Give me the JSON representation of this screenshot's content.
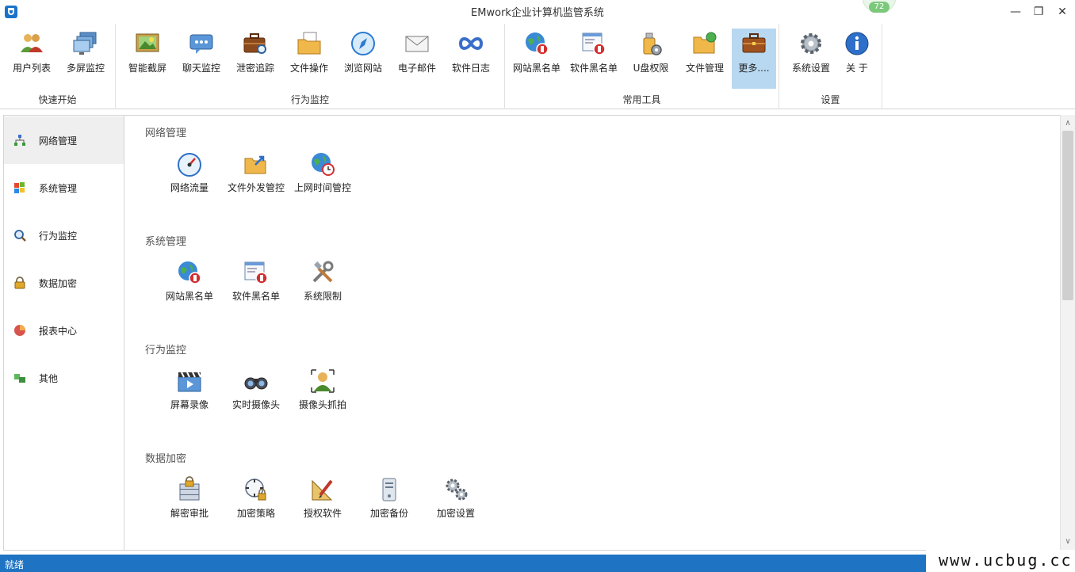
{
  "window": {
    "title": "EMwork企业计算机监管系统",
    "badge": "72",
    "min": "—",
    "max": "❐",
    "close": "✕"
  },
  "ribbon": {
    "groups": [
      {
        "label": "快速开始",
        "buttons": [
          {
            "label": "用户列表",
            "icon": "users-icon"
          },
          {
            "label": "多屏监控",
            "icon": "multi-screen-icon"
          }
        ]
      },
      {
        "label": "行为监控",
        "buttons": [
          {
            "label": "智能截屏",
            "icon": "screenshot-icon"
          },
          {
            "label": "聊天监控",
            "icon": "chat-icon"
          },
          {
            "label": "泄密追踪",
            "icon": "briefcase-search-icon"
          },
          {
            "label": "文件操作",
            "icon": "file-folder-icon"
          },
          {
            "label": "浏览网站",
            "icon": "compass-icon"
          },
          {
            "label": "电子邮件",
            "icon": "mail-icon"
          },
          {
            "label": "软件日志",
            "icon": "infinity-icon"
          }
        ]
      },
      {
        "label": "常用工具",
        "buttons": [
          {
            "label": "网站黑名单",
            "icon": "globe-block-icon"
          },
          {
            "label": "软件黑名单",
            "icon": "window-block-icon"
          },
          {
            "label": "U盘权限",
            "icon": "usb-gear-icon"
          },
          {
            "label": "文件管理",
            "icon": "folder-globe-icon"
          },
          {
            "label": "更多....",
            "icon": "toolbox-icon"
          }
        ]
      },
      {
        "label": "设置",
        "buttons": [
          {
            "label": "系统设置",
            "icon": "gear-icon"
          },
          {
            "label": "关 于",
            "icon": "info-icon"
          }
        ]
      }
    ]
  },
  "sidebar": {
    "items": [
      {
        "label": "网络管理",
        "icon": "network-icon"
      },
      {
        "label": "系统管理",
        "icon": "windows-logo-icon"
      },
      {
        "label": "行为监控",
        "icon": "magnifier-icon"
      },
      {
        "label": "数据加密",
        "icon": "lock-icon"
      },
      {
        "label": "报表中心",
        "icon": "pie-chart-icon"
      },
      {
        "label": "其他",
        "icon": "blocks-icon"
      }
    ]
  },
  "sections": [
    {
      "title": "网络管理",
      "items": [
        {
          "label": "网络流量",
          "icon": "speedometer-icon"
        },
        {
          "label": "文件外发管控",
          "icon": "folder-send-icon"
        },
        {
          "label": "上网时间管控",
          "icon": "globe-clock-icon"
        }
      ]
    },
    {
      "title": "系统管理",
      "items": [
        {
          "label": "网站黑名单",
          "icon": "globe-block-icon"
        },
        {
          "label": "软件黑名单",
          "icon": "window-block-icon"
        },
        {
          "label": "系统限制",
          "icon": "tools-icon"
        }
      ]
    },
    {
      "title": "行为监控",
      "items": [
        {
          "label": "屏幕录像",
          "icon": "clapper-icon"
        },
        {
          "label": "实时摄像头",
          "icon": "binoculars-icon"
        },
        {
          "label": "摄像头抓拍",
          "icon": "person-capture-icon"
        }
      ]
    },
    {
      "title": "数据加密",
      "items": [
        {
          "label": "解密审批",
          "icon": "lock-cabinet-icon"
        },
        {
          "label": "加密策略",
          "icon": "target-lock-icon"
        },
        {
          "label": "授权软件",
          "icon": "pen-ruler-icon"
        },
        {
          "label": "加密备份",
          "icon": "server-icon"
        },
        {
          "label": "加密设置",
          "icon": "gears-icon"
        }
      ]
    }
  ],
  "status": {
    "text": "就绪"
  },
  "watermark": {
    "text": "www.ucbug.cc"
  },
  "scroll": {
    "up": "∧",
    "down": "∨"
  }
}
